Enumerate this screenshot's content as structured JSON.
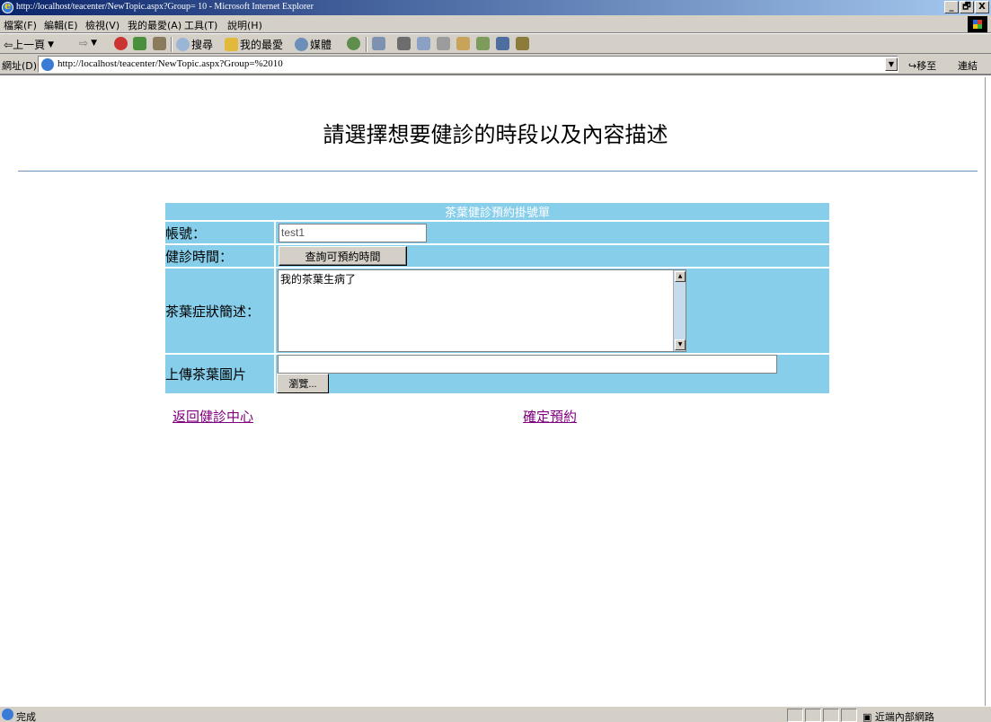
{
  "window": {
    "title": "http://localhost/teacenter/NewTopic.aspx?Group= 10 - Microsoft Internet Explorer",
    "controls": [
      "_",
      "🗗",
      "X"
    ]
  },
  "menu": [
    "檔案(F)",
    "編輯(E)",
    "檢視(V)",
    "我的最愛(A)",
    "工具(T)",
    "說明(H)"
  ],
  "toolbar": {
    "back": "上一頁",
    "search": "搜尋",
    "favorites": "我的最愛",
    "media": "媒體"
  },
  "address": {
    "label": "網址(D)",
    "url": "http://localhost/teacenter/NewTopic.aspx?Group=%2010",
    "go": "移至",
    "links": "連結"
  },
  "page": {
    "heading": "請選擇想要健診的時段以及內容描述",
    "form": {
      "header": "茶葉健診預約掛號單",
      "account_label": "帳號：",
      "account_value": "test1",
      "time_label": "健診時間：",
      "time_button": "查詢可預約時間",
      "symptom_label": "茶葉症狀簡述：",
      "symptom_value": "我的茶葉生病了",
      "upload_label": "上傳茶葉圖片",
      "browse_button": "瀏覽..."
    },
    "links": {
      "back": "返回健診中心",
      "confirm": "確定預約"
    }
  },
  "status": {
    "text": "完成",
    "zone": "近端內部網路"
  },
  "colors": {
    "form_bg": "#87ceeb",
    "visited_link": "#800080",
    "rule": "#6b93b8"
  }
}
